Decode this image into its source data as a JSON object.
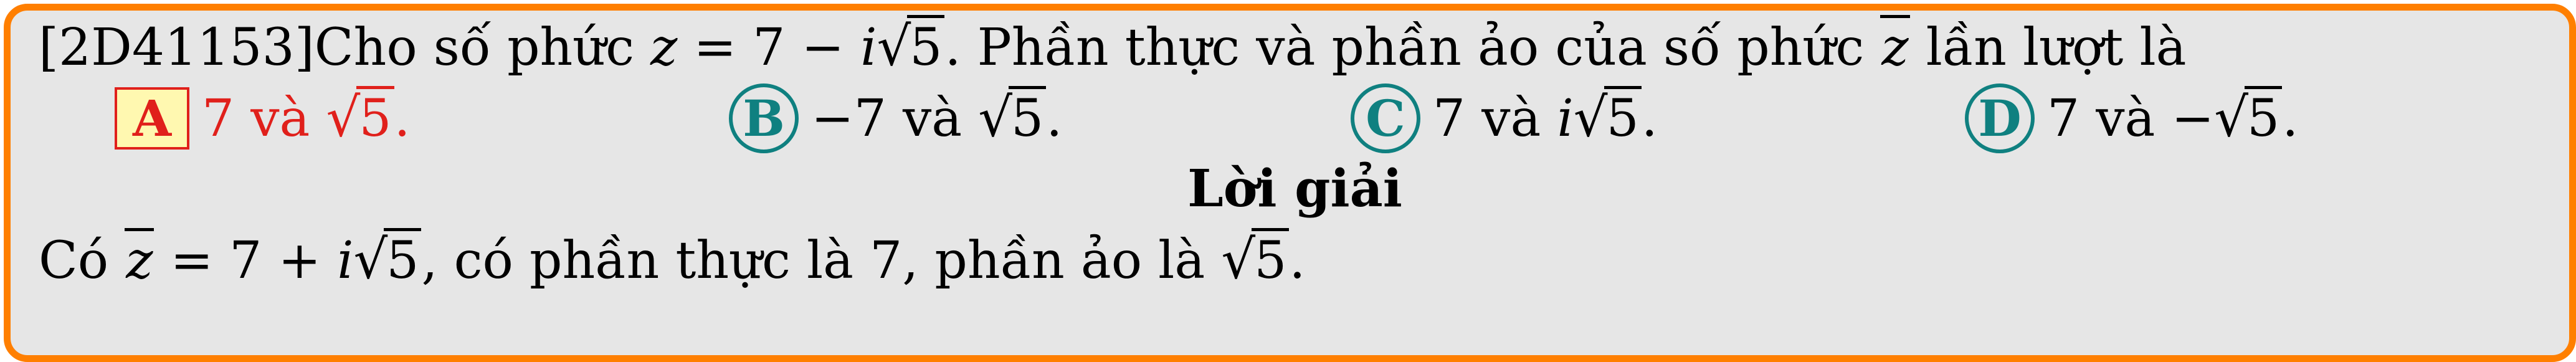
{
  "question": {
    "code": "[2D41153]",
    "text_before": "Cho số phức ",
    "equation_lhs": "z",
    "equation_mid": " = 7 − ",
    "equation_i": "i",
    "equation_radicand": "5",
    "text_after": ". Phần thực và phần ảo của số phức ",
    "conj_var": "z",
    "text_end": " lần lượt là"
  },
  "options": [
    {
      "letter": "A",
      "prefix": "7 và ",
      "radicand": "5",
      "suffix": "."
    },
    {
      "letter": "B",
      "prefix": "−7 và ",
      "radicand": "5",
      "suffix": "."
    },
    {
      "letter": "C",
      "prefix": "7 và ",
      "ivar": "i",
      "radicand": "5",
      "suffix": "."
    },
    {
      "letter": "D",
      "prefix": "7 và −",
      "radicand": "5",
      "suffix": "."
    }
  ],
  "solution": {
    "heading": "Lời giải",
    "text_start": "Có ",
    "conj_var": "z",
    "eq_mid": " = 7 + ",
    "eq_i": "i",
    "eq_radicand": "5",
    "text_mid": ", có phần thực là 7, phần ảo là ",
    "end_radicand": "5",
    "text_end": "."
  },
  "colors": {
    "frame_border": "#ff7f00",
    "frame_fill": "#e6e6e6",
    "correct_answer": "#e0201b",
    "option_badge": "#0f8080",
    "correct_badge_fill": "#fff8b0"
  }
}
